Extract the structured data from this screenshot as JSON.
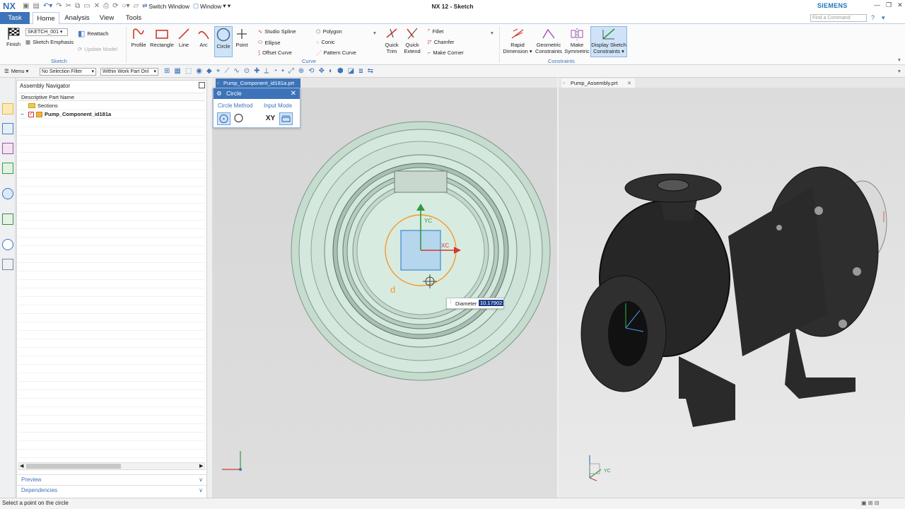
{
  "app": {
    "logo": "NX",
    "title": "NX 12 - Sketch",
    "brand": "SIEMENS",
    "switch_window": "Switch Window",
    "window_menu": "Window"
  },
  "tabs": [
    "Task",
    "Home",
    "Analysis",
    "View",
    "Tools"
  ],
  "active_tab": "Home",
  "command_search_placeholder": "Find a Command",
  "ribbon": {
    "finish": "Finish",
    "sketch_name": "SKETCH_001",
    "reattach": "Reattach",
    "sketch_emphasis": "Sketch Emphasis",
    "update_model": "Update Model",
    "group_sketch": "Sketch",
    "profile": "Profile",
    "rectangle": "Rectangle",
    "line": "Line",
    "arc": "Arc",
    "circle": "Circle",
    "point": "Point",
    "studio_spline": "Studio Spline",
    "ellipse": "Ellipse",
    "offset_curve": "Offset Curve",
    "polygon": "Polygon",
    "conic": "Conic",
    "pattern_curve": "Pattern Curve",
    "quick_trim": [
      "Quick",
      "Trim"
    ],
    "quick_extend": [
      "Quick",
      "Extend"
    ],
    "fillet": "Fillet",
    "chamfer": "Chamfer",
    "make_corner": "Make Corner",
    "group_curve": "Curve",
    "rapid_dimension": [
      "Rapid",
      "Dimension ▾"
    ],
    "geometric_constraints": [
      "Geometric",
      "Constraints"
    ],
    "make_symmetric": [
      "Make",
      "Symmetric"
    ],
    "display_sketch_constraints": [
      "Display Sketch",
      "Constraints ▾"
    ],
    "group_constraints": "Constraints"
  },
  "selection_bar": {
    "menu": "Menu ▾",
    "filter": "No Selection Filter",
    "scope": "Within Work Part Onl"
  },
  "navigator": {
    "title": "Assembly Navigator",
    "column": "Descriptive Part Name",
    "items": [
      "Sections",
      "Pump_Component_id181a"
    ],
    "preview": "Preview",
    "dependencies": "Dependencies"
  },
  "viewport1": {
    "tab": "Pump_Component_id181a.prt",
    "dialog_title": "Circle",
    "circle_method": "Circle Method",
    "input_mode": "Input Mode",
    "xy_label": "XY",
    "diameter_label": "Diameter",
    "diameter_value": "10.17902",
    "axis_x": "XC",
    "axis_y": "YC"
  },
  "viewport2": {
    "tab": "Pump_Assembly.prt",
    "axis_y": "YC"
  },
  "status": {
    "prompt": "Select a point on the circle"
  },
  "colors": {
    "accent": "#3d73b8",
    "brand": "#1a78b8",
    "sketch_face": "#d4e8de",
    "circle_preview": "#f39a2b",
    "part_body": "#2a2a2a"
  }
}
